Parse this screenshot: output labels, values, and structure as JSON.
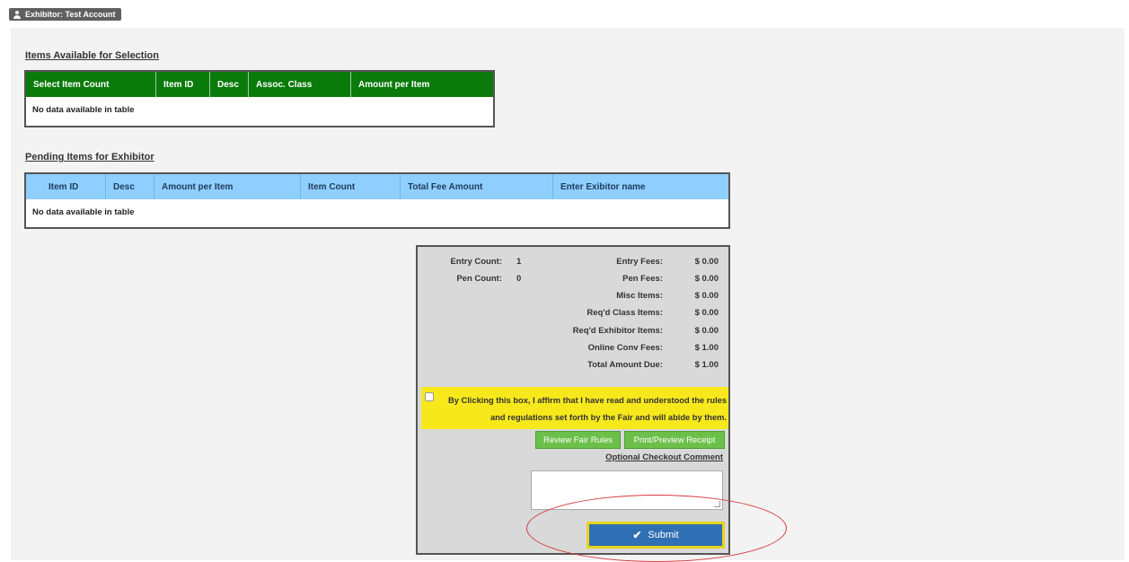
{
  "badge": {
    "label": "Exhibitor: Test Account",
    "icon": "user-icon"
  },
  "available": {
    "title": "Items Available for Selection",
    "headers": [
      "Select Item Count",
      "Item ID",
      "Desc",
      "Assoc. Class",
      "Amount per Item"
    ],
    "empty": "No data available in table"
  },
  "pending": {
    "title": "Pending Items for Exhibitor",
    "headers": [
      "Item ID",
      "Desc",
      "Amount per Item",
      "Item Count",
      "Total Fee Amount",
      "Enter Exibitor name"
    ],
    "empty": "No data available in table"
  },
  "summary": {
    "entry_count_label": "Entry Count:",
    "entry_count": "1",
    "pen_count_label": "Pen Count:",
    "pen_count": "0",
    "fees": [
      {
        "label": "Entry Fees:",
        "value": "$ 0.00"
      },
      {
        "label": "Pen Fees:",
        "value": "$ 0.00"
      },
      {
        "label": "Misc Items:",
        "value": "$ 0.00"
      },
      {
        "label": "Req'd Class Items:",
        "value": "$ 0.00"
      },
      {
        "label": "Req'd Exhibitor Items:",
        "value": "$ 0.00"
      },
      {
        "label": "Online Conv Fees:",
        "value": "$ 1.00"
      },
      {
        "label": "Total Amount Due:",
        "value": "$ 1.00"
      }
    ],
    "agree_text": "By Clicking this box, I affirm that I have read and understood the rules and regulations set forth by the Fair and will abide by them.",
    "review_button": "Review Fair Rules",
    "print_button": "Print/Preview Receipt",
    "comment_label": "Optional Checkout Comment",
    "comment_value": "",
    "submit_label": "Submit"
  },
  "colors": {
    "green_header": "#0a7a0a",
    "blue_header": "#8fcfff",
    "agree_bg": "#f7e81c",
    "submit_bg": "#2f6fb3",
    "annotation": "#d43a3a"
  }
}
